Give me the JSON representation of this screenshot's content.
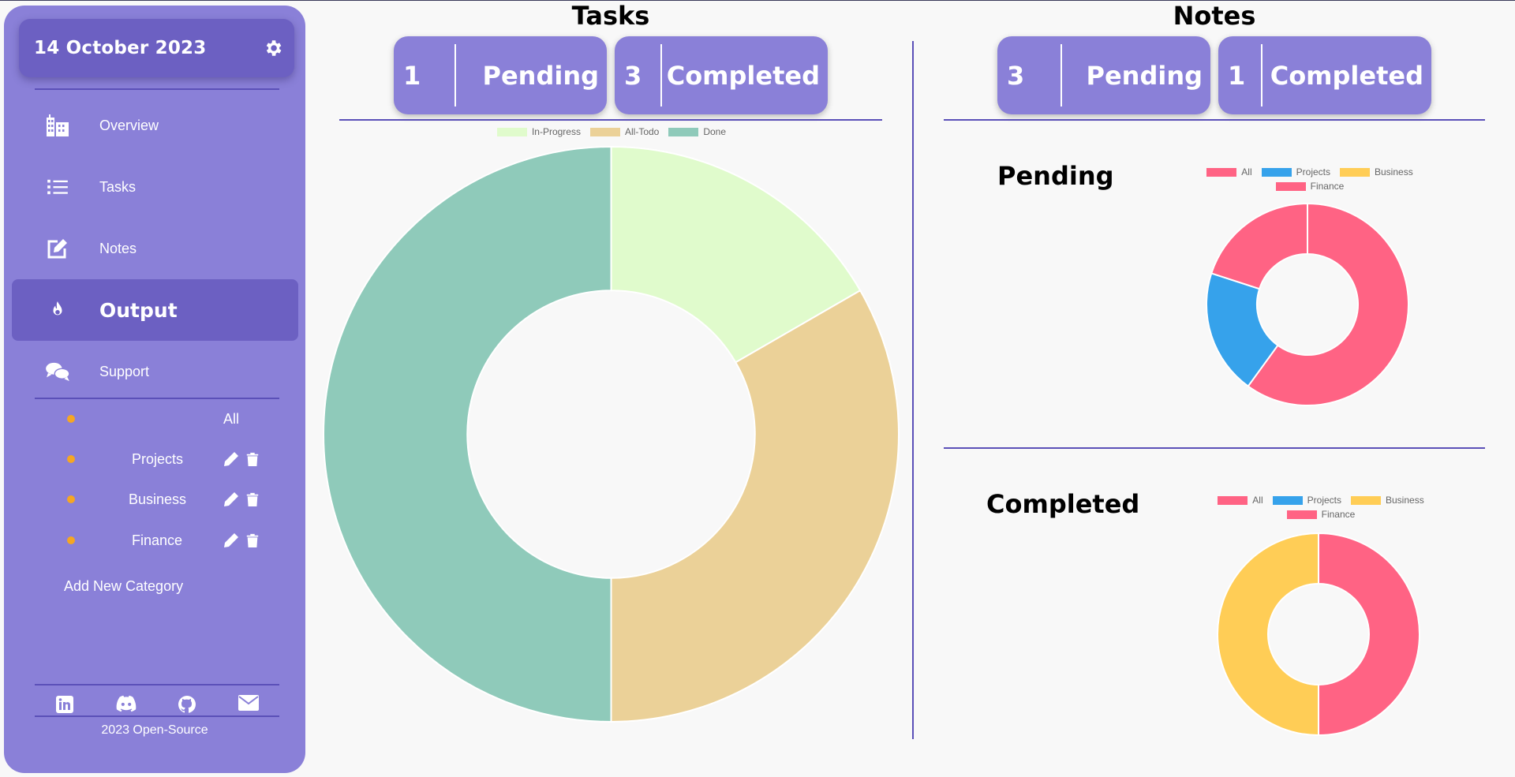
{
  "sidebar": {
    "date": "14 October 2023",
    "nav": [
      {
        "label": "Overview",
        "icon": "building-icon"
      },
      {
        "label": "Tasks",
        "icon": "list-icon"
      },
      {
        "label": "Notes",
        "icon": "edit-icon"
      },
      {
        "label": "Output",
        "icon": "fire-icon",
        "active": true
      },
      {
        "label": "Support",
        "icon": "comments-icon"
      }
    ],
    "categories": [
      {
        "label": "All"
      },
      {
        "label": "Projects"
      },
      {
        "label": "Business"
      },
      {
        "label": "Finance"
      }
    ],
    "add_category": "Add New Category",
    "social": [
      "linkedin-icon",
      "discord-icon",
      "github-icon",
      "mail-icon"
    ],
    "footer": "2023 Open-Source"
  },
  "tasks": {
    "title": "Tasks",
    "pending": {
      "count": "1",
      "label": "Pending"
    },
    "completed": {
      "count": "3",
      "label": "Completed"
    }
  },
  "notes": {
    "title": "Notes",
    "pending": {
      "count": "3",
      "label": "Pending"
    },
    "completed": {
      "count": "1",
      "label": "Completed"
    },
    "pending_title": "Pending",
    "completed_title": "Completed"
  },
  "colors": {
    "sidebar": "#8a80d8",
    "accent": "#6c60c2",
    "in_progress": "#e0fbcc",
    "all_todo": "#ebd198",
    "done": "#8fcaba",
    "pink": "#ff6384",
    "blue": "#36a2eb",
    "yellow": "#ffcd56"
  },
  "chart_data": [
    {
      "type": "pie",
      "labels": [
        "In-Progress",
        "All-Todo",
        "Done"
      ],
      "values": [
        1,
        2,
        3
      ],
      "colors": [
        "#e0fbcc",
        "#ebd198",
        "#8fcaba"
      ]
    },
    {
      "type": "pie",
      "title": "Pending",
      "labels": [
        "All",
        "Projects",
        "Business",
        "Finance"
      ],
      "values": [
        3,
        1,
        0,
        1
      ],
      "colors": [
        "#ff6384",
        "#36a2eb",
        "#ffcd56",
        "#ff6384"
      ]
    },
    {
      "type": "pie",
      "title": "Completed",
      "labels": [
        "All",
        "Projects",
        "Business",
        "Finance"
      ],
      "values": [
        1,
        0,
        1,
        0
      ],
      "colors": [
        "#ff6384",
        "#36a2eb",
        "#ffcd56",
        "#ff6384"
      ]
    }
  ]
}
